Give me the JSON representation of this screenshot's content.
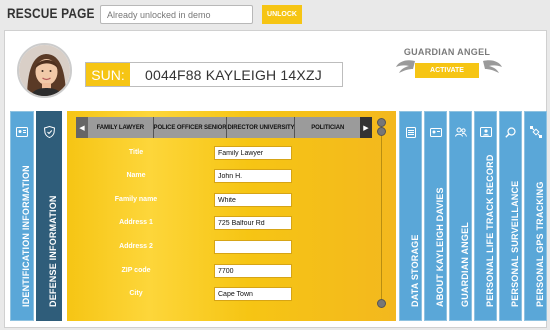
{
  "header": {
    "title": "RESCUE PAGE",
    "unlock_placeholder": "Already unlocked in demo",
    "unlock_label": "UNLOCK"
  },
  "profile": {
    "sun_label": "SUN:",
    "sun_value": "0044F88 KAYLEIGH 14XZJ"
  },
  "guardian": {
    "title": "GUARDIAN ANGEL",
    "activate_label": "ACTIVATE"
  },
  "left_tabs": [
    {
      "label": "IDENTIFICATION INFORMATION",
      "icon": "id-card-icon"
    },
    {
      "label": "DEFENSE INFORMATION",
      "icon": "shield-icon"
    }
  ],
  "category_tabs": [
    "FAMILY LAWYER",
    "POLICE OFFICER SENIOR",
    "DIRECTOR UNIVERSITY",
    "POLITICIAN"
  ],
  "form_fields": [
    {
      "label": "Title",
      "value": "Family Lawyer"
    },
    {
      "label": "Name",
      "value": "John H."
    },
    {
      "label": "Family name",
      "value": "White"
    },
    {
      "label": "Address 1",
      "value": "725 Balfour Rd"
    },
    {
      "label": "Address 2",
      "value": ""
    },
    {
      "label": "ZIP code",
      "value": "7700"
    },
    {
      "label": "City",
      "value": "Cape Town"
    }
  ],
  "right_tabs": [
    {
      "label": "DATA STORAGE",
      "icon": "storage-icon"
    },
    {
      "label": "ABOUT  KAYLEIGH DAVIES",
      "icon": "id-badge-icon"
    },
    {
      "label": "GUARDIAN ANGEL",
      "icon": "people-icon"
    },
    {
      "label": "PERSONAL LIFE TRACK RECORD",
      "icon": "profile-card-icon"
    },
    {
      "label": "PERSONAL SURVEILLANCE",
      "icon": "search-icon"
    },
    {
      "label": "PERSONAL GPS TRACKING",
      "icon": "satellite-icon"
    }
  ],
  "colors": {
    "accent_yellow": "#f6c514",
    "tab_blue": "#5aa7d8",
    "tab_dark": "#2f5d7a"
  }
}
